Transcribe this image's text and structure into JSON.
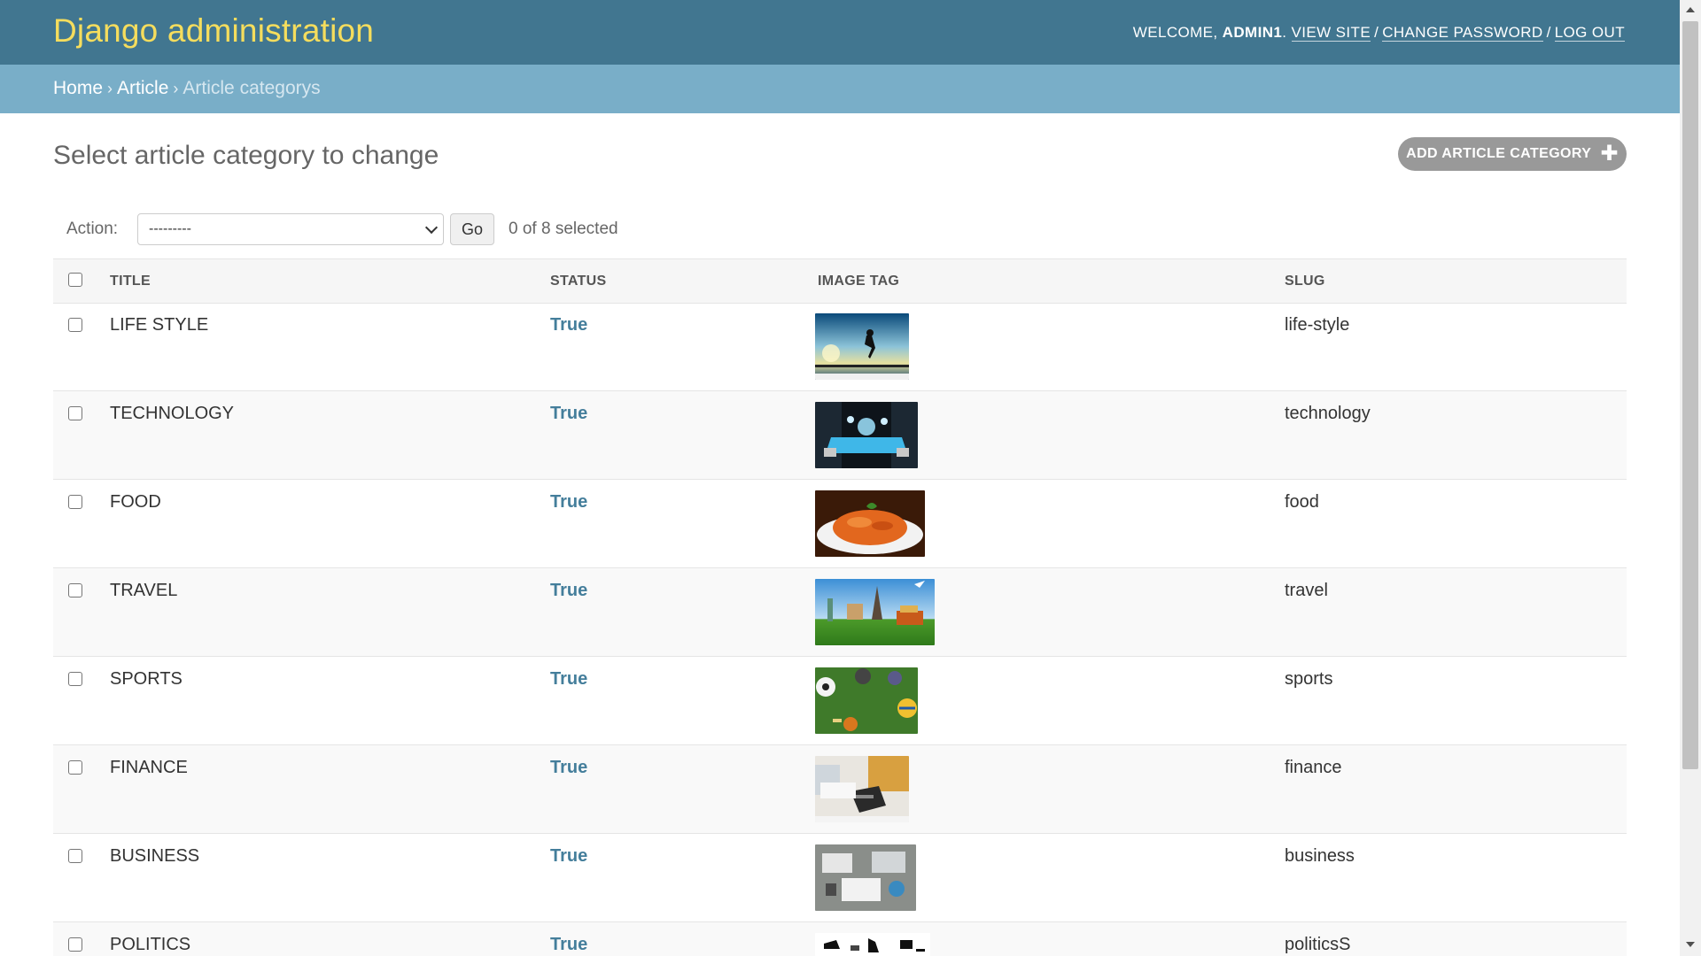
{
  "header": {
    "branding": "Django administration",
    "welcome": "WELCOME,",
    "username": "ADMIN1",
    "view_site": "VIEW SITE",
    "change_password": "CHANGE PASSWORD",
    "log_out": "LOG OUT"
  },
  "breadcrumbs": {
    "home": "Home",
    "app": "Article",
    "current": "Article categorys",
    "separator": "›"
  },
  "content": {
    "title": "Select article category to change",
    "add_button": "ADD ARTICLE CATEGORY",
    "add_icon": "plus-icon"
  },
  "actions": {
    "label": "Action:",
    "select_value": "---------",
    "go": "Go",
    "selected_count": "0 of 8 selected"
  },
  "table": {
    "columns": [
      "TITLE",
      "STATUS",
      "IMAGE TAG",
      "SLUG"
    ],
    "rows": [
      {
        "title": "LIFE STYLE",
        "status": "True",
        "slug": "life-style"
      },
      {
        "title": "TECHNOLOGY",
        "status": "True",
        "slug": "technology"
      },
      {
        "title": "FOOD",
        "status": "True",
        "slug": "food"
      },
      {
        "title": "TRAVEL",
        "status": "True",
        "slug": "travel"
      },
      {
        "title": "SPORTS",
        "status": "True",
        "slug": "sports"
      },
      {
        "title": "FINANCE",
        "status": "True",
        "slug": "finance"
      },
      {
        "title": "BUSINESS",
        "status": "True",
        "slug": "business"
      },
      {
        "title": "POLITICS",
        "status": "True",
        "slug": "politicsS"
      }
    ]
  },
  "colors": {
    "header_bg": "#417690",
    "branding": "#f5dd5d",
    "breadcrumbs_bg": "#79aec8",
    "status_link": "#447e9b",
    "add_button_bg": "#999999"
  }
}
